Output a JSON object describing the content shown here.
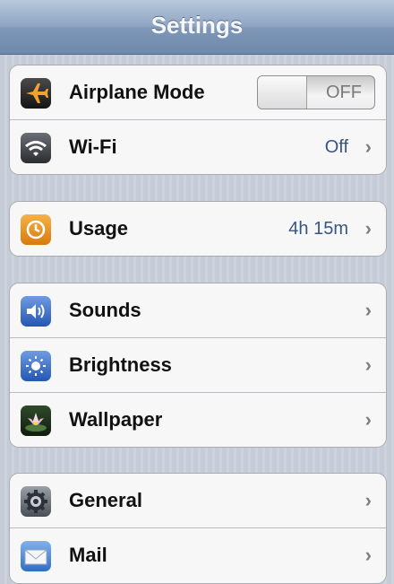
{
  "navbar": {
    "title": "Settings"
  },
  "groups": [
    {
      "rows": [
        {
          "label": "Airplane Mode",
          "icon": "airplane-icon",
          "toggle": "OFF"
        },
        {
          "label": "Wi-Fi",
          "icon": "wifi-icon",
          "value": "Off"
        }
      ]
    },
    {
      "rows": [
        {
          "label": "Usage",
          "icon": "clock-icon",
          "value": "4h 15m"
        }
      ]
    },
    {
      "rows": [
        {
          "label": "Sounds",
          "icon": "speaker-icon"
        },
        {
          "label": "Brightness",
          "icon": "sun-icon"
        },
        {
          "label": "Wallpaper",
          "icon": "flower-icon"
        }
      ]
    },
    {
      "rows": [
        {
          "label": "General",
          "icon": "gear-icon"
        },
        {
          "label": "Mail",
          "icon": "envelope-icon"
        }
      ]
    }
  ],
  "chevron": "›",
  "colors": {
    "navbar": "#7f98b8",
    "value_text": "#385487",
    "usage_icon": "#e8901a"
  }
}
